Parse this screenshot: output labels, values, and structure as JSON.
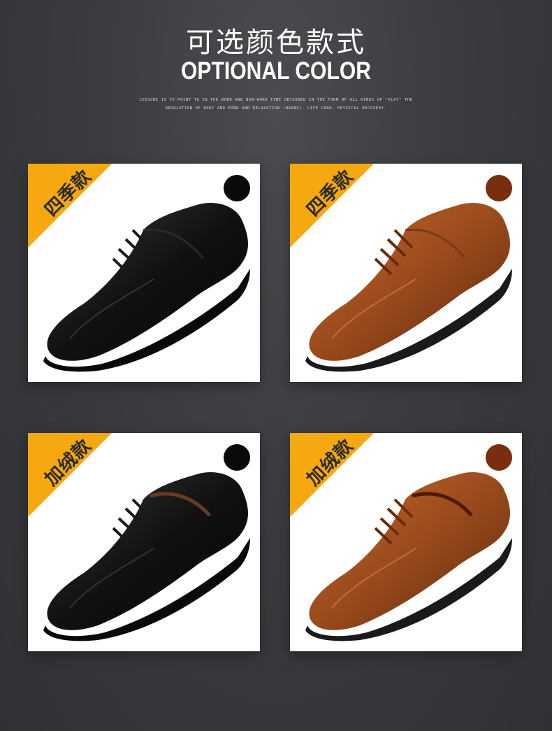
{
  "header": {
    "title_cn": "可选颜色款式",
    "title_en": "OPTIONAL COLOR",
    "tagline_line1": "LEISURE IS TO POINT TO IN THE WORK AND NON-WORK TIME OBTAINED IN THE FORM OF ALL KINDS OF \"PLAY\" THE",
    "tagline_line2": "REGULATION OF BODY AND MIND AND RELAXATION (HADBX). LIFE CARE, PHYSICAL RECOVERY."
  },
  "colors": {
    "ribbon": "#f5a80f",
    "black_swatch": "#0a0a0a",
    "brown_swatch": "#7a2e10"
  },
  "products": [
    {
      "badge": "四季款",
      "color_name": "black"
    },
    {
      "badge": "四季款",
      "color_name": "brown"
    },
    {
      "badge": "加绒款",
      "color_name": "black"
    },
    {
      "badge": "加绒款",
      "color_name": "brown"
    }
  ]
}
